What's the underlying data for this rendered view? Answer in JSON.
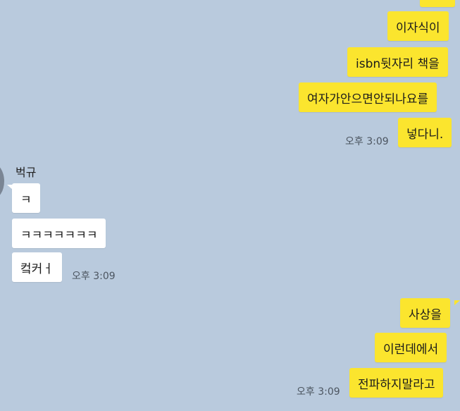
{
  "chat": {
    "me_group1": {
      "messages": [
        "이자식이",
        "isbn뒷자리 책을",
        "여자가안으면안되나요를",
        "넣다니."
      ],
      "time": "오후 3:09"
    },
    "other_group": {
      "sender": "벅규",
      "messages": [
        "ㅋ",
        "ㅋㅋㅋㅋㅋㅋㅋ",
        "컼커ㅓ"
      ],
      "time": "오후 3:09"
    },
    "me_group2": {
      "messages": [
        "사상을",
        "이런데에서",
        "전파하지말라고"
      ],
      "time": "오후 3:09"
    }
  },
  "colors": {
    "background": "#b9cadd",
    "my_bubble": "#fbe52e",
    "other_bubble": "#ffffff"
  }
}
